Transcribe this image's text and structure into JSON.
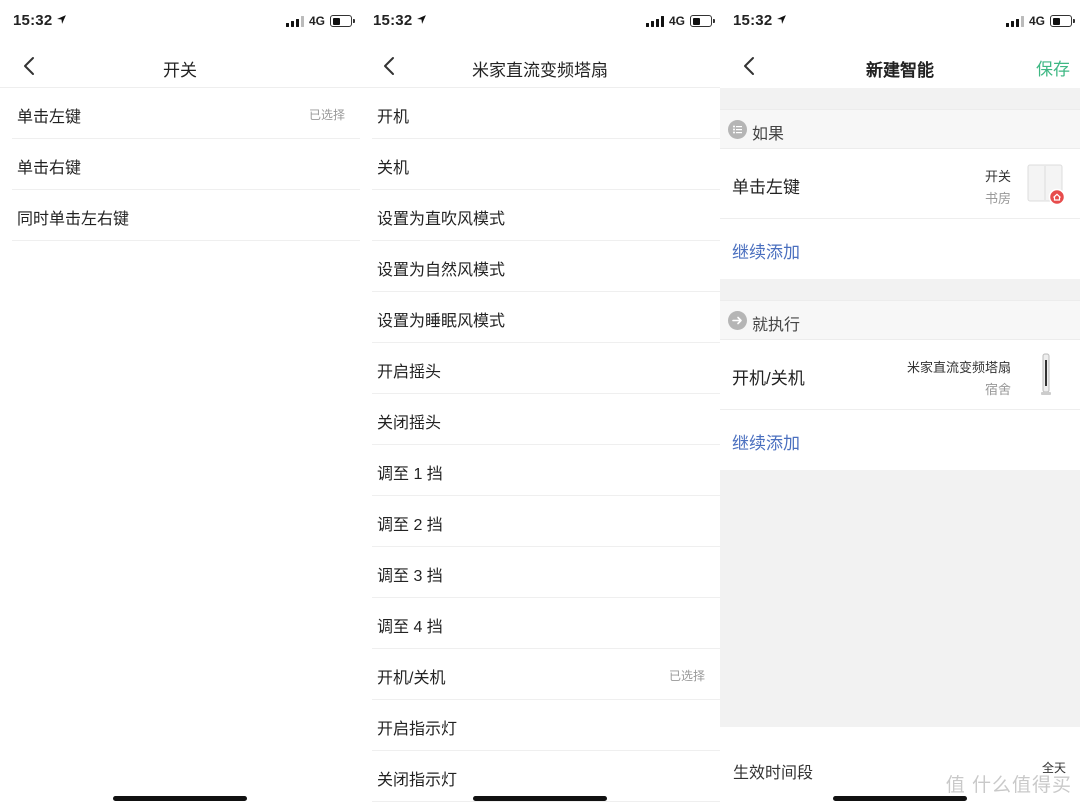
{
  "status": {
    "time": "15:32",
    "network": "4G"
  },
  "panel1": {
    "title": "开关",
    "items": [
      {
        "label": "单击左键",
        "tag": "已选择"
      },
      {
        "label": "单击右键",
        "tag": ""
      },
      {
        "label": "同时单击左右键",
        "tag": ""
      }
    ]
  },
  "panel2": {
    "title": "米家直流变频塔扇",
    "items": [
      {
        "label": "开机",
        "tag": ""
      },
      {
        "label": "关机",
        "tag": ""
      },
      {
        "label": "设置为直吹风模式",
        "tag": ""
      },
      {
        "label": "设置为自然风模式",
        "tag": ""
      },
      {
        "label": "设置为睡眠风模式",
        "tag": ""
      },
      {
        "label": "开启摇头",
        "tag": ""
      },
      {
        "label": "关闭摇头",
        "tag": ""
      },
      {
        "label": "调至 1 挡",
        "tag": ""
      },
      {
        "label": "调至 2 挡",
        "tag": ""
      },
      {
        "label": "调至 3 挡",
        "tag": ""
      },
      {
        "label": "调至 4 挡",
        "tag": ""
      },
      {
        "label": "开机/关机",
        "tag": "已选择"
      },
      {
        "label": "开启指示灯",
        "tag": ""
      },
      {
        "label": "关闭指示灯",
        "tag": ""
      }
    ]
  },
  "panel3": {
    "title": "新建智能",
    "save_label": "保存",
    "if_section": {
      "header": "如果",
      "condition": {
        "label": "单击左键",
        "device": "开关",
        "room": "书房"
      },
      "add_label": "继续添加"
    },
    "then_section": {
      "header": "就执行",
      "action": {
        "label": "开机/关机",
        "device": "米家直流变频塔扇",
        "room": "宿舍"
      },
      "add_label": "继续添加"
    },
    "time_period": {
      "label": "生效时间段",
      "value": "全天"
    },
    "watermark": "值 什么值得买",
    "accent_color": "#3fb884",
    "link_color": "#4a6fbf"
  }
}
